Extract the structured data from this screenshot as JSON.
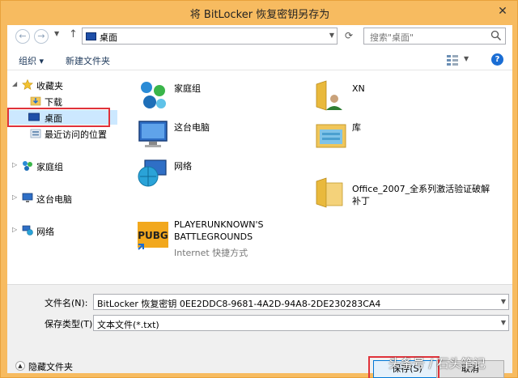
{
  "window": {
    "title": "将 BitLocker 恢复密钥另存为",
    "close_glyph": "✕"
  },
  "address_bar": {
    "back": "←",
    "forward": "→",
    "up": "↑",
    "path": "桌面",
    "refresh": "⟳"
  },
  "search": {
    "placeholder": "搜索\"桌面\""
  },
  "toolbar": {
    "organize": "组织 ▾",
    "new_folder": "新建文件夹",
    "help": "?"
  },
  "nav": {
    "items": [
      {
        "label": "收藏夹"
      },
      {
        "label": "下载"
      },
      {
        "label": "桌面"
      },
      {
        "label": "最近访问的位置"
      },
      {
        "label": "家庭组"
      },
      {
        "label": "这台电脑"
      },
      {
        "label": "网络"
      }
    ]
  },
  "files": [
    {
      "label": "家庭组"
    },
    {
      "label": "这台电脑"
    },
    {
      "label": "网络"
    },
    {
      "label_line1": "PLAYERUNKNOWN'S",
      "label_line2": "BATTLEGROUNDS",
      "sub": "Internet 快捷方式"
    },
    {
      "label": "XN"
    },
    {
      "label": "库"
    },
    {
      "label_line1": "Office_2007_全系列激活验证破解",
      "label_line2": "补丁"
    }
  ],
  "save": {
    "filename_label": "文件名(N):",
    "filename_value": "BitLocker 恢复密钥 0EE2DDC8-9681-4A2D-94A8-2DE230283CA4",
    "type_label": "保存类型(T):",
    "type_value": "文本文件(*.txt)",
    "hide_folders": "隐藏文件夹",
    "save_button": "保存(S)",
    "cancel_button": "取消"
  },
  "watermark": "头条号 / 石头笔记",
  "colors": {
    "frame": "#f7bb60",
    "selection": "#cce8ff",
    "highlight_box": "#e0323a",
    "accent": "#0078d7"
  }
}
